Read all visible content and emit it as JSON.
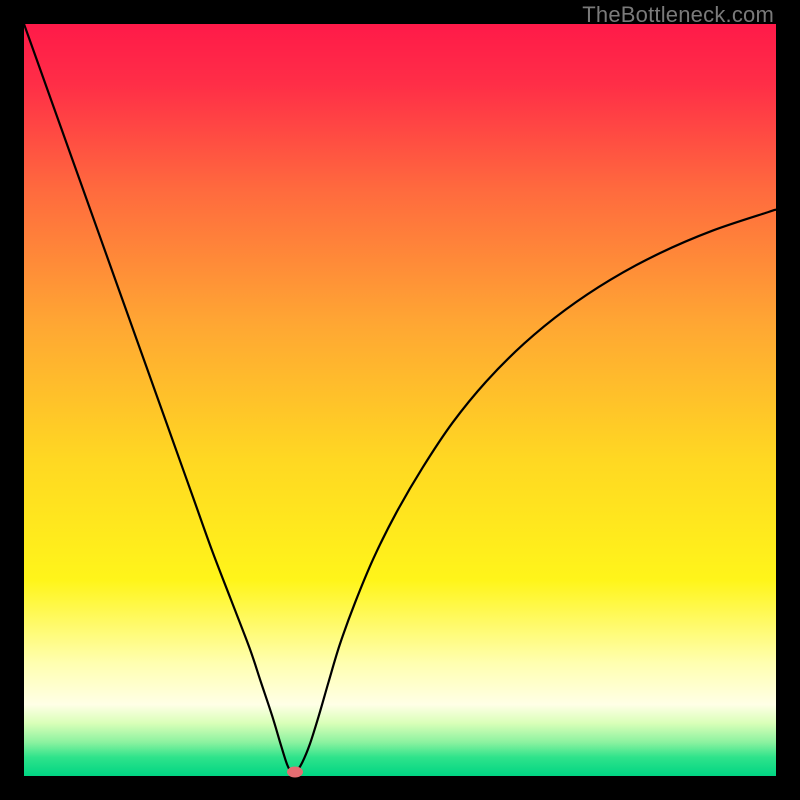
{
  "watermark": "TheBottleneck.com",
  "chart_data": {
    "type": "line",
    "title": "",
    "xlabel": "",
    "ylabel": "",
    "xlim": [
      0,
      100
    ],
    "ylim": [
      0,
      100
    ],
    "background_gradient": {
      "stops": [
        {
          "offset": 0,
          "color": "#ff1a49"
        },
        {
          "offset": 0.08,
          "color": "#ff2e47"
        },
        {
          "offset": 0.22,
          "color": "#ff6a3e"
        },
        {
          "offset": 0.4,
          "color": "#ffa733"
        },
        {
          "offset": 0.58,
          "color": "#ffd822"
        },
        {
          "offset": 0.74,
          "color": "#fff51a"
        },
        {
          "offset": 0.85,
          "color": "#ffffb0"
        },
        {
          "offset": 0.905,
          "color": "#ffffe6"
        },
        {
          "offset": 0.93,
          "color": "#d9ffb8"
        },
        {
          "offset": 0.955,
          "color": "#8cf2a0"
        },
        {
          "offset": 0.975,
          "color": "#2fe38b"
        },
        {
          "offset": 1.0,
          "color": "#00d583"
        }
      ]
    },
    "series": [
      {
        "name": "bottleneck-curve",
        "color": "#000000",
        "x": [
          0.0,
          2.5,
          5.0,
          7.5,
          10.0,
          12.5,
          15.0,
          17.5,
          20.0,
          22.5,
          25.0,
          27.5,
          30.0,
          31.5,
          33.0,
          34.2,
          35.0,
          35.6,
          36.2,
          37.0,
          38.0,
          39.2,
          40.5,
          42.0,
          44.0,
          46.5,
          49.5,
          53.0,
          57.0,
          61.5,
          66.5,
          72.0,
          78.0,
          84.5,
          91.5,
          99.0,
          100.0
        ],
        "y": [
          100.0,
          93.0,
          86.0,
          79.0,
          72.0,
          65.0,
          58.0,
          51.0,
          44.0,
          37.0,
          30.0,
          23.5,
          17.0,
          12.5,
          8.0,
          4.0,
          1.5,
          0.5,
          0.6,
          1.8,
          4.2,
          8.0,
          12.5,
          17.5,
          23.0,
          29.0,
          35.0,
          41.0,
          47.0,
          52.5,
          57.5,
          62.0,
          66.0,
          69.5,
          72.5,
          75.0,
          75.3
        ]
      }
    ],
    "marker": {
      "x": 36.0,
      "y": 0.5,
      "color": "#e46d72"
    }
  }
}
